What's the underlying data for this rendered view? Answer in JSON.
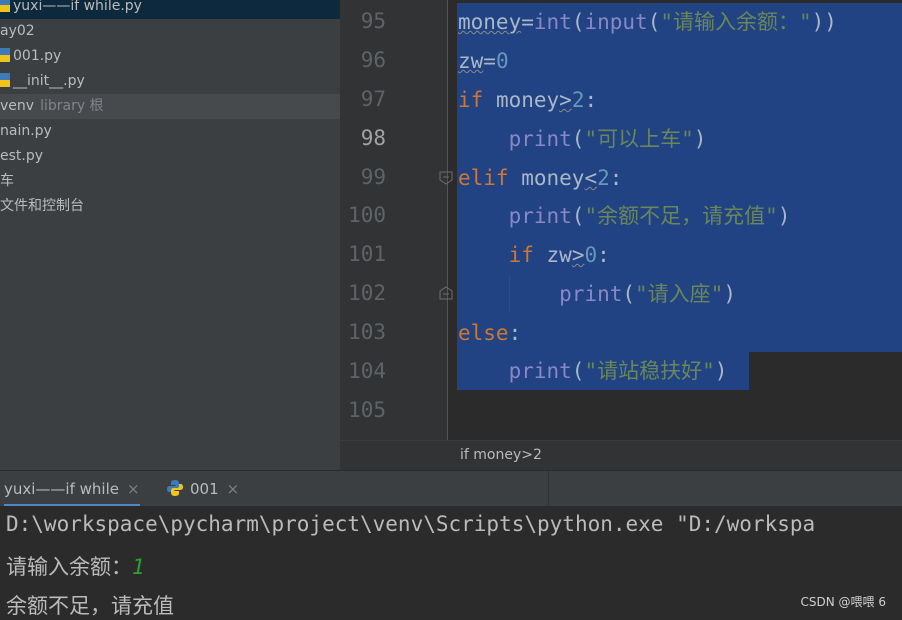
{
  "project_tree": [
    {
      "label": "yuxi——if  while.py",
      "icon": "python-file-icon",
      "selected": true
    },
    {
      "label": "ay02",
      "icon": ""
    },
    {
      "label": "001.py",
      "icon": "python-file-icon"
    },
    {
      "label": "__init__.py",
      "icon": "python-file-icon"
    },
    {
      "label": "venv",
      "suffix": "library 根",
      "icon": "",
      "library": true
    },
    {
      "label": "nain.py",
      "icon": ""
    },
    {
      "label": "est.py",
      "icon": ""
    },
    {
      "label": "车",
      "icon": ""
    },
    {
      "label": "文件和控制台",
      "icon": ""
    }
  ],
  "editor": {
    "line_numbers": [
      "95",
      "96",
      "97",
      "98",
      "99",
      "100",
      "101",
      "102",
      "103",
      "104",
      "105"
    ],
    "current_line": "98",
    "code": {
      "l95": {
        "var": "money",
        "op": "=",
        "fn1": "int",
        "p1": "(",
        "fn2": "input",
        "p2": "(",
        "str": "\"请输入余额：\"",
        "p3": "))"
      },
      "l96": {
        "var": "zw",
        "op": "=",
        "num": "0"
      },
      "l97": {
        "kw": "if",
        "var": "money",
        "op": ">",
        "num": "2",
        "colon": ":"
      },
      "l98": {
        "fn": "print",
        "p1": "(",
        "str": "\"可以上车\"",
        "p2": ")"
      },
      "l99": {
        "kw": "elif",
        "var": "money",
        "op": "<",
        "num": "2",
        "colon": ":"
      },
      "l100": {
        "fn": "print",
        "p1": "(",
        "str": "\"余额不足，请充值\"",
        "p2": ")"
      },
      "l101": {
        "kw": "if",
        "var": "zw",
        "op": ">",
        "num": "0",
        "colon": ":"
      },
      "l102": {
        "fn": "print",
        "p1": "(",
        "str": "\"请入座\"",
        "p2": ")"
      },
      "l103": {
        "kw": "else",
        "colon": ":"
      },
      "l104": {
        "fn": "print",
        "p1": "(",
        "str": "\"请站稳扶好\"",
        "p2": ")"
      }
    },
    "breadcrumb": "if money>2"
  },
  "run_tabs": [
    {
      "label": "yuxi——if  while",
      "close": "×",
      "active": true
    },
    {
      "label": "001",
      "close": "×",
      "icon": "python-icon"
    }
  ],
  "console": {
    "command": "D:\\workspace\\pycharm\\project\\venv\\Scripts\\python.exe \"D:/workspa",
    "prompt": "请输入余额：",
    "input": "1",
    "output": "余额不足，请充值"
  },
  "watermark": "CSDN @喂喂 6",
  "colors": {
    "selection": "#214283",
    "keyword": "#cc7832",
    "builtin": "#8888c6",
    "string": "#6a8759",
    "number": "#6897bb"
  }
}
